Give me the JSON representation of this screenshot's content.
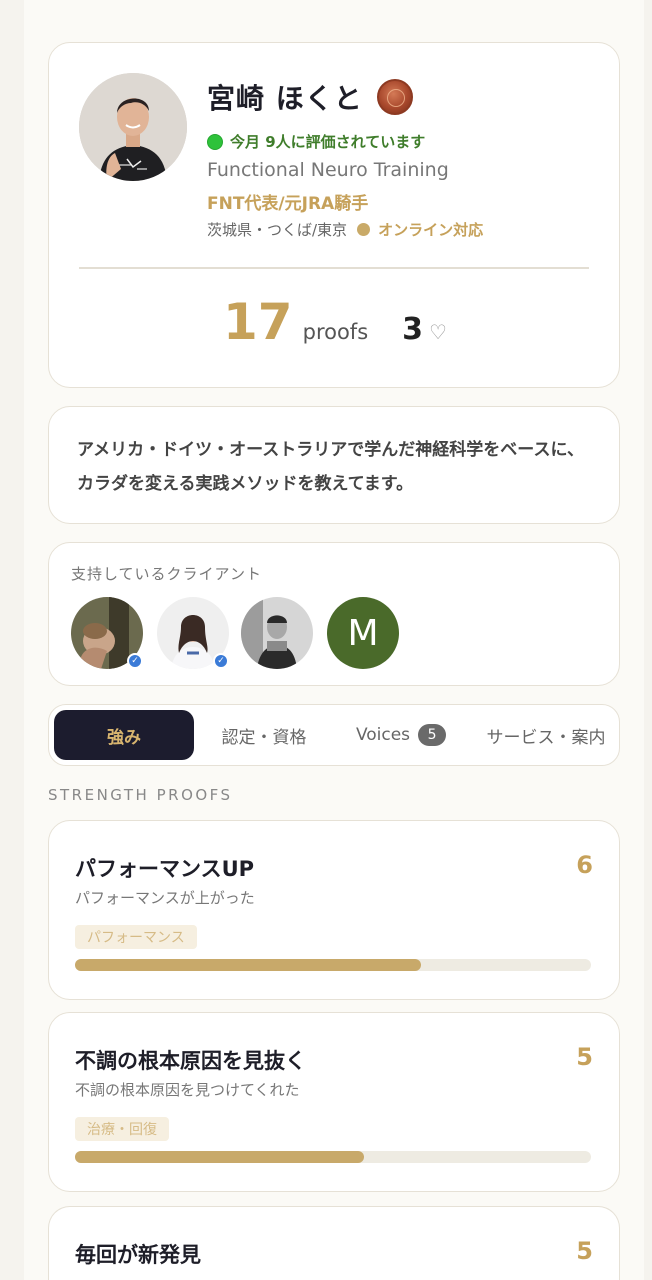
{
  "profile": {
    "name": "宮崎 ほくと",
    "evaluation": "今月 9人に評価されています",
    "subtitle": "Functional Neuro Training",
    "role": "FNT代表/元JRA騎手",
    "location": "茨城県・つくば/東京",
    "online": "オンライン対応",
    "proofs_count": "17",
    "proofs_label": "proofs",
    "likes_count": "3",
    "heart_icon": "heart-outline-icon"
  },
  "bio": {
    "text": "アメリカ・ドイツ・オーストラリアで学んだ神経科学をベースに、カラダを変える実践メソッドを教えてます。"
  },
  "clients": {
    "title": "支持しているクライアント",
    "items": [
      {
        "verified": true
      },
      {
        "verified": true
      },
      {
        "verified": false
      },
      {
        "initial": "M",
        "color": "#4a6a2a",
        "verified": false
      }
    ]
  },
  "tabs": [
    {
      "label": "強み",
      "active": true
    },
    {
      "label": "認定・資格",
      "active": false
    },
    {
      "label": "Voices",
      "count": "5",
      "active": false
    },
    {
      "label": "サービス・案内",
      "active": false
    }
  ],
  "section_label": "STRENGTH PROOFS",
  "strengths": [
    {
      "title": "パフォーマンスUP",
      "count": "6",
      "desc": "パフォーマンスが上がった",
      "tag": "パフォーマンス",
      "level": 0.67
    },
    {
      "title": "不調の根本原因を見抜く",
      "count": "5",
      "desc": "不調の根本原因を見つけてくれた",
      "tag": "治療・回復",
      "level": 0.56
    },
    {
      "title": "毎回が新発見",
      "count": "5"
    }
  ],
  "colors": {
    "accent_gold": "#c6a15a",
    "active_tab_bg": "#1c1c2e",
    "eval_green": "#3f7d2b"
  }
}
